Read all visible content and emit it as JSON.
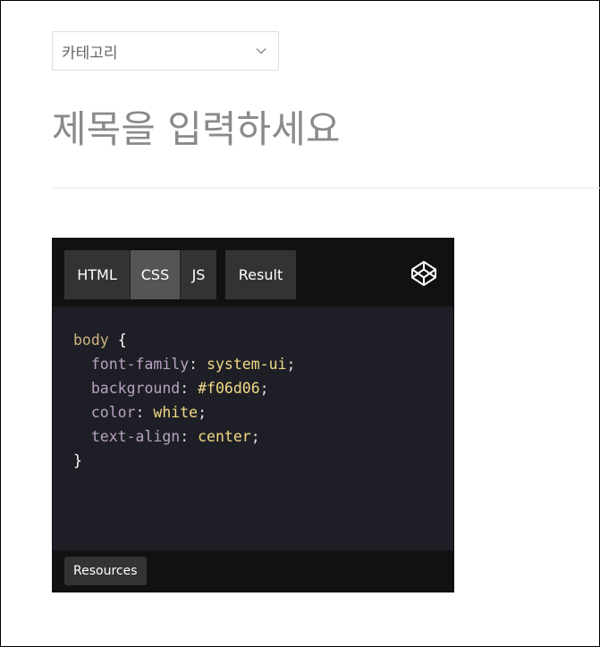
{
  "category": {
    "label": "카테고리"
  },
  "post": {
    "title_placeholder": "제목을 입력하세요"
  },
  "embed": {
    "tabs": [
      "HTML",
      "CSS",
      "JS",
      "Result"
    ],
    "active_tab": "CSS",
    "logo_icon": "codepen-icon",
    "code": {
      "selector": "body",
      "open_brace": "{",
      "close_brace": "}",
      "declarations": [
        {
          "prop": "font-family",
          "value": "system-ui"
        },
        {
          "prop": "background",
          "value": "#f06d06"
        },
        {
          "prop": "color",
          "value": "white"
        },
        {
          "prop": "text-align",
          "value": "center"
        }
      ]
    },
    "resources_label": "Resources",
    "colors": {
      "background": "#1e1f26",
      "header": "#111111",
      "tab": "#333333",
      "active_tab": "#555555",
      "selector": "#d0b481",
      "property": "#b8a2c2",
      "value": "#f3da84"
    }
  }
}
